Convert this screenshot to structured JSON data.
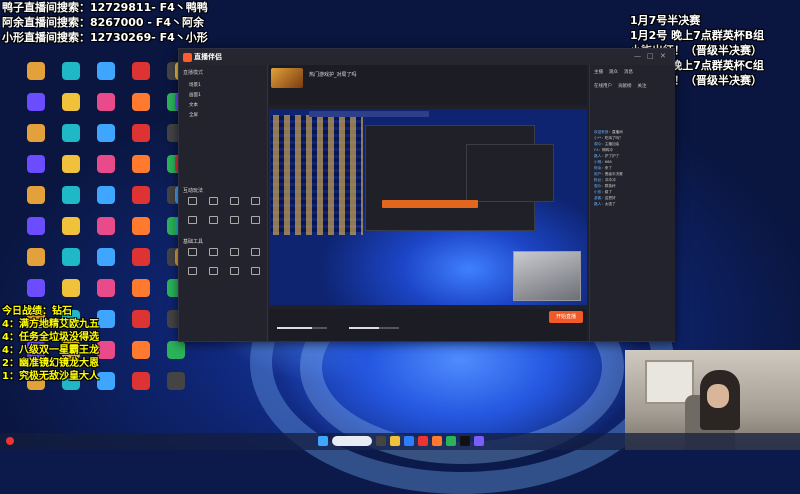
{
  "overlay_left": {
    "line1": "鸭子直播间搜索：12729811- F4丶鸭鸭",
    "line2": "阿余直播间搜索：8267000 - F4丶阿余",
    "line3": "小形直播间搜索：12730269- F4丶小形"
  },
  "overlay_right": {
    "line1": "1月7号半决赛",
    "line2": "1月2号 晚上7点群英杯B组",
    "line3": "小柒出征！（晋级半决赛）",
    "line4": "1月3号 晚上7点群英杯C组",
    "line5": "阿文出征！（晋级半决赛）"
  },
  "overlay_rank": {
    "line1": "今日战绩：钻石",
    "line2": "4：满方地精艾欧九五",
    "line3": "4：任务全垃圾没得选",
    "line4": "4：八级双一星霸王龙",
    "line5": "2：幽准镜幻镜龙大恩",
    "line6": "1：究极无敌沙皇大人"
  },
  "app": {
    "name": "直播伴侣",
    "left_header": "直播模式",
    "scene_items": [
      "场景1",
      "画面1",
      "文本",
      "全屏"
    ],
    "section_tools": "互动玩法",
    "section_tools2": "基础工具",
    "center_title": "热门游戏护_对局了吗",
    "start_label": "开始直播",
    "right_tabs": [
      "主播",
      "观众",
      "消息"
    ],
    "right_tabs2": [
      "在线用户",
      "贡献榜",
      "关注"
    ]
  },
  "chat": [
    {
      "user": "欢迎来到",
      "text": "直播间"
    },
    {
      "user": "小**",
      "text": "吃鸡了吗？"
    },
    {
      "user": "观众",
      "text": "主播加油"
    },
    {
      "user": "F4",
      "text": "鸭鸭冲"
    },
    {
      "user": "路人",
      "text": "护了护了"
    },
    {
      "user": "小明",
      "text": "666"
    },
    {
      "user": "阿余",
      "text": "来了"
    },
    {
      "user": "用户",
      "text": "晋级半决赛"
    },
    {
      "user": "粉丝",
      "text": "冲冲冲"
    },
    {
      "user": "观众",
      "text": "群英杯"
    },
    {
      "user": "小形",
      "text": "稳了"
    },
    {
      "user": "游客",
      "text": "这把好"
    },
    {
      "user": "路人",
      "text": "太强了"
    }
  ],
  "colors": {
    "accent": "#f05a28",
    "overlay_yellow": "#ffff00"
  }
}
